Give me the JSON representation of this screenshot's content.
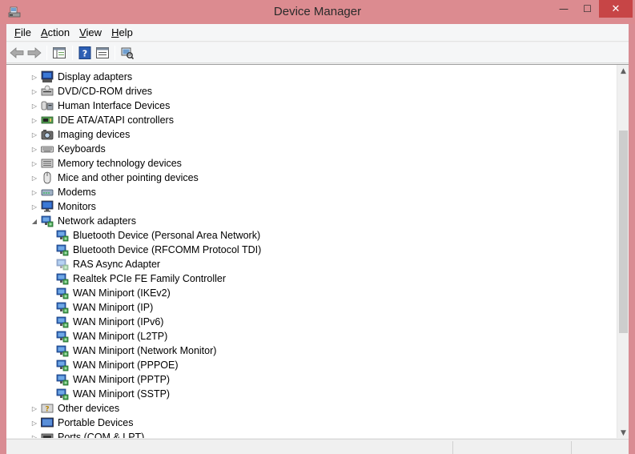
{
  "window": {
    "title": "Device Manager",
    "icon": "device-manager-icon"
  },
  "window_controls": {
    "minimize": "—",
    "maximize": "☐",
    "close": "✕"
  },
  "menu": [
    {
      "accel": "F",
      "rest": "ile"
    },
    {
      "accel": "A",
      "rest": "ction"
    },
    {
      "accel": "V",
      "rest": "iew"
    },
    {
      "accel": "H",
      "rest": "elp"
    }
  ],
  "toolbar": [
    "back-icon",
    "forward-icon",
    "show-hide-console-tree-icon",
    "help-icon",
    "properties-icon",
    "scan-hardware-icon"
  ],
  "tree": {
    "items": [
      {
        "label": "Display adapters",
        "level": 0,
        "expanded": false,
        "icon": "display-adapter-icon"
      },
      {
        "label": "DVD/CD-ROM drives",
        "level": 0,
        "expanded": false,
        "icon": "dvd-drive-icon"
      },
      {
        "label": "Human Interface Devices",
        "level": 0,
        "expanded": false,
        "icon": "hid-icon"
      },
      {
        "label": "IDE ATA/ATAPI controllers",
        "level": 0,
        "expanded": false,
        "icon": "ide-controller-icon"
      },
      {
        "label": "Imaging devices",
        "level": 0,
        "expanded": false,
        "icon": "camera-icon"
      },
      {
        "label": "Keyboards",
        "level": 0,
        "expanded": false,
        "icon": "keyboard-icon"
      },
      {
        "label": "Memory technology devices",
        "level": 0,
        "expanded": false,
        "icon": "memory-icon"
      },
      {
        "label": "Mice and other pointing devices",
        "level": 0,
        "expanded": false,
        "icon": "mouse-icon"
      },
      {
        "label": "Modems",
        "level": 0,
        "expanded": false,
        "icon": "modem-icon"
      },
      {
        "label": "Monitors",
        "level": 0,
        "expanded": false,
        "icon": "monitor-icon"
      },
      {
        "label": "Network adapters",
        "level": 0,
        "expanded": true,
        "icon": "network-adapter-icon"
      },
      {
        "label": "Bluetooth Device (Personal Area Network)",
        "level": 1,
        "icon": "network-adapter-icon"
      },
      {
        "label": "Bluetooth Device (RFCOMM Protocol TDI)",
        "level": 1,
        "icon": "network-adapter-icon"
      },
      {
        "label": "RAS Async Adapter",
        "level": 1,
        "icon": "network-adapter-icon",
        "dimmed": true
      },
      {
        "label": "Realtek PCIe FE Family Controller",
        "level": 1,
        "icon": "network-adapter-icon"
      },
      {
        "label": "WAN Miniport (IKEv2)",
        "level": 1,
        "icon": "network-adapter-icon"
      },
      {
        "label": "WAN Miniport (IP)",
        "level": 1,
        "icon": "network-adapter-icon"
      },
      {
        "label": "WAN Miniport (IPv6)",
        "level": 1,
        "icon": "network-adapter-icon"
      },
      {
        "label": "WAN Miniport (L2TP)",
        "level": 1,
        "icon": "network-adapter-icon"
      },
      {
        "label": "WAN Miniport (Network Monitor)",
        "level": 1,
        "icon": "network-adapter-icon"
      },
      {
        "label": "WAN Miniport (PPPOE)",
        "level": 1,
        "icon": "network-adapter-icon"
      },
      {
        "label": "WAN Miniport (PPTP)",
        "level": 1,
        "icon": "network-adapter-icon"
      },
      {
        "label": "WAN Miniport (SSTP)",
        "level": 1,
        "icon": "network-adapter-icon"
      },
      {
        "label": "Other devices",
        "level": 0,
        "expanded": false,
        "icon": "unknown-device-icon"
      },
      {
        "label": "Portable Devices",
        "level": 0,
        "expanded": false,
        "icon": "portable-device-icon"
      },
      {
        "label": "Ports (COM & LPT)",
        "level": 0,
        "expanded": false,
        "icon": "port-icon"
      }
    ]
  },
  "colors": {
    "titlebar": "#dc8b90",
    "close_button": "#c74546",
    "pane": "#ffffff"
  }
}
